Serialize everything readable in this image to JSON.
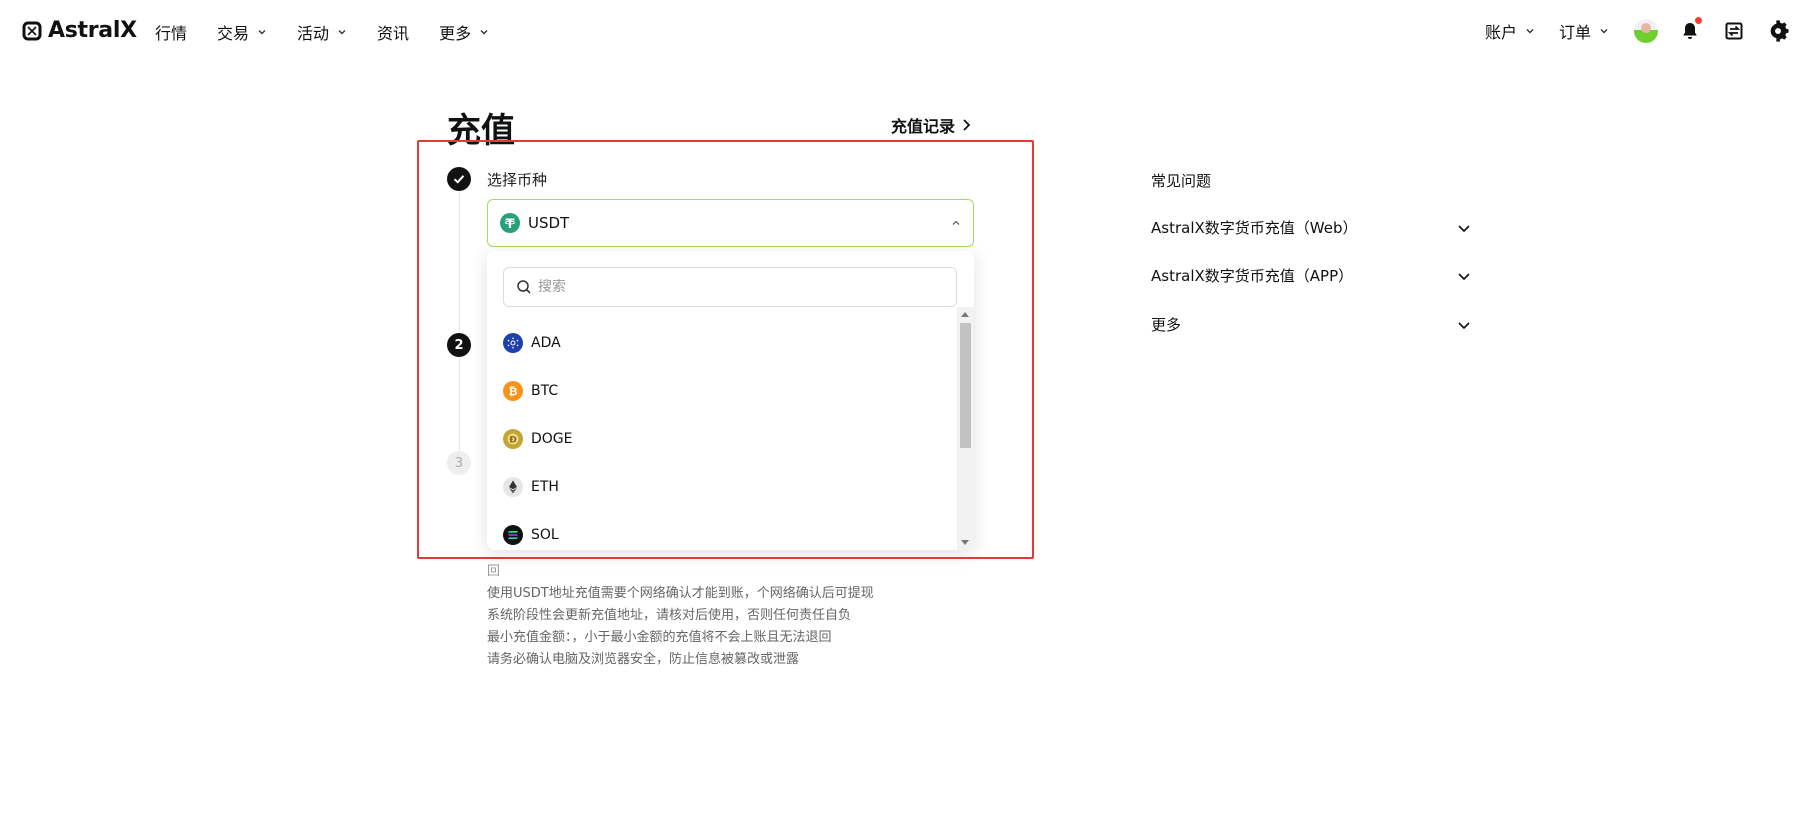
{
  "brand": {
    "name": "AstralX"
  },
  "nav": {
    "left": [
      {
        "label": "行情",
        "dropdown": false
      },
      {
        "label": "交易",
        "dropdown": true
      },
      {
        "label": "活动",
        "dropdown": true
      },
      {
        "label": "资讯",
        "dropdown": false
      },
      {
        "label": "更多",
        "dropdown": true
      }
    ],
    "right": [
      {
        "label": "账户",
        "dropdown": true
      },
      {
        "label": "订单",
        "dropdown": true
      }
    ],
    "icons": [
      "avatar",
      "bell-icon",
      "exchange-icon",
      "gear-icon"
    ],
    "notification_dot_color": "#ff3b30"
  },
  "page": {
    "title": "充值",
    "history_link": "充值记录"
  },
  "steps": {
    "step1_label": "选择币种",
    "step2_number": "2",
    "step3_number": "3",
    "selected_coin": "USDT",
    "selected_coin_color": "#26a17b",
    "select_border_color": "#9ee05a"
  },
  "dropdown": {
    "search_placeholder": "搜索",
    "items": [
      {
        "label": "ADA",
        "icon": "ada-icon",
        "color": "#1e3fae"
      },
      {
        "label": "BTC",
        "icon": "btc-icon",
        "color": "#f7931a"
      },
      {
        "label": "DOGE",
        "icon": "doge-icon",
        "color": "#c2a633"
      },
      {
        "label": "ETH",
        "icon": "eth-icon",
        "color": "#e6e6e6"
      },
      {
        "label": "SOL",
        "icon": "sol-icon",
        "color": "#111111"
      }
    ]
  },
  "notes": {
    "partial_line": "回",
    "lines": [
      "使用USDT地址充值需要个网络确认才能到账，个网络确认后可提现",
      "系统阶段性会更新充值地址，请核对后使用，否则任何责任自负",
      "最小充值金额：，小于最小金额的充值将不会上账且无法退回",
      "请务必确认电脑及浏览器安全，防止信息被篡改或泄露"
    ]
  },
  "faq": {
    "title": "常见问题",
    "items": [
      "AstralX数字货币充值（Web）",
      "AstralX数字货币充值（APP）",
      "更多"
    ]
  },
  "highlight_color": "#e53935"
}
